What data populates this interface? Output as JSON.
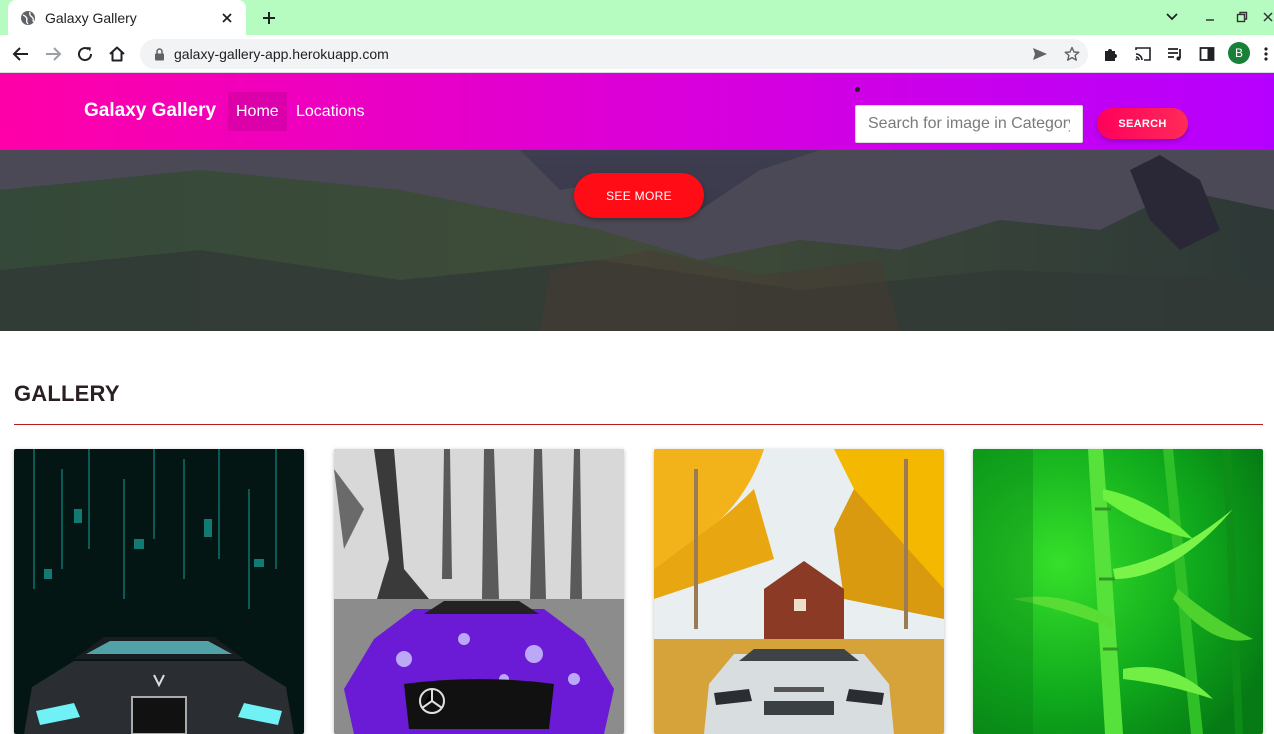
{
  "browser": {
    "tab_title": "Galaxy Gallery",
    "url": "galaxy-gallery-app.herokuapp.com",
    "profile_initial": "B"
  },
  "navbar": {
    "brand": "Galaxy Gallery",
    "links": [
      {
        "label": "Home",
        "active": true
      },
      {
        "label": "Locations",
        "active": false
      }
    ],
    "search_placeholder": "Search for image in Category",
    "search_button": "SEARCH"
  },
  "hero": {
    "button": "SEE MORE"
  },
  "gallery": {
    "title": "GALLERY",
    "cards": [
      {
        "subject": "black car matrix background"
      },
      {
        "subject": "purple car forest"
      },
      {
        "subject": "white suv autumn house"
      },
      {
        "subject": "green bamboo"
      }
    ]
  },
  "colors": {
    "tabbar": "#b6fcc1",
    "navbar_start": "#ff00a8",
    "navbar_end": "#b600ff",
    "search_button": "#ff005c",
    "see_more": "#ff0c17",
    "divider": "#b71c1c"
  }
}
